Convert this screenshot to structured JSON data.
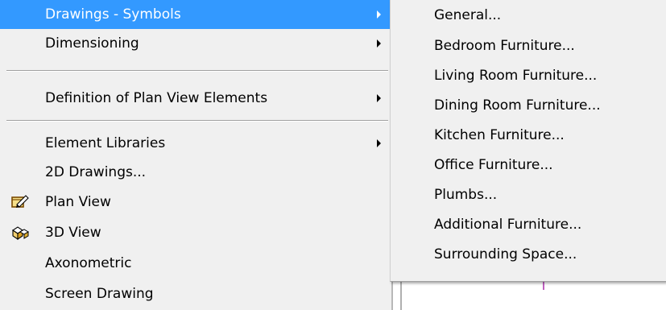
{
  "left_menu": {
    "items": [
      {
        "label": "Drawings - Symbols",
        "has_submenu": true,
        "highlighted": true
      },
      {
        "label": "Dimensioning",
        "has_submenu": true
      },
      {
        "label": "Definition of Plan View Elements",
        "has_submenu": true
      },
      {
        "label": "Element Libraries",
        "has_submenu": true
      },
      {
        "label": "2D Drawings..."
      },
      {
        "label": "Plan View",
        "icon": "plan-view-icon"
      },
      {
        "label": "3D View",
        "icon": "3d-view-icon"
      },
      {
        "label": "Axonometric"
      },
      {
        "label": "Screen Drawing"
      }
    ]
  },
  "submenu": {
    "items": [
      {
        "label": "General..."
      },
      {
        "label": "Bedroom Furniture..."
      },
      {
        "label": "Living Room Furniture..."
      },
      {
        "label": "Dining Room Furniture..."
      },
      {
        "label": "Kitchen Furniture..."
      },
      {
        "label": "Office Furniture..."
      },
      {
        "label": "Plumbs..."
      },
      {
        "label": "Additional Furniture..."
      },
      {
        "label": "Surrounding Space..."
      }
    ]
  },
  "colors": {
    "menu_background": "#f0f0f0",
    "highlight_background": "#3399ff",
    "highlight_text": "#ffffff",
    "text": "#000000"
  }
}
